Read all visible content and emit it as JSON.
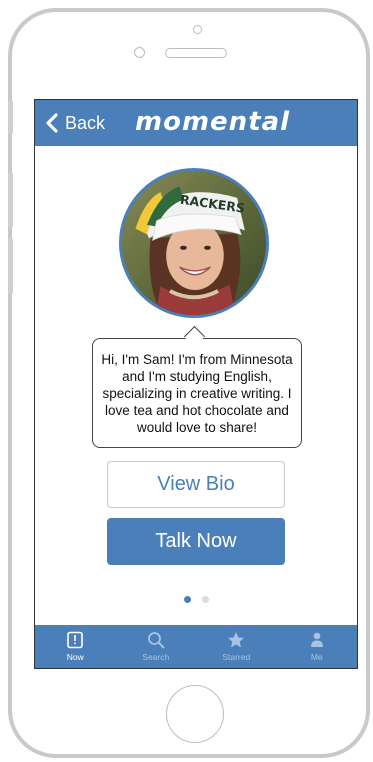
{
  "header": {
    "back_label": "Back",
    "brand": "momental"
  },
  "profile": {
    "bio_text": "Hi, I'm Sam! I'm from Minnesota and I'm studying English, specializing in creative writing. I love tea and hot chocolate and would love to share!",
    "hat_text": "RACKERS",
    "view_bio_label": "View Bio",
    "talk_now_label": "Talk Now"
  },
  "pager": {
    "pages": 2,
    "current": 1
  },
  "tabs": [
    {
      "label": "Now",
      "icon": "now-icon",
      "active": true
    },
    {
      "label": "Search",
      "icon": "search-icon",
      "active": false
    },
    {
      "label": "Starred",
      "icon": "star-icon",
      "active": false
    },
    {
      "label": "Me",
      "icon": "person-icon",
      "active": false
    }
  ],
  "colors": {
    "brand_blue": "#4a7fb9",
    "inactive_tab_label": "#a9c4e2",
    "frame_gray": "#c9c9c9"
  }
}
